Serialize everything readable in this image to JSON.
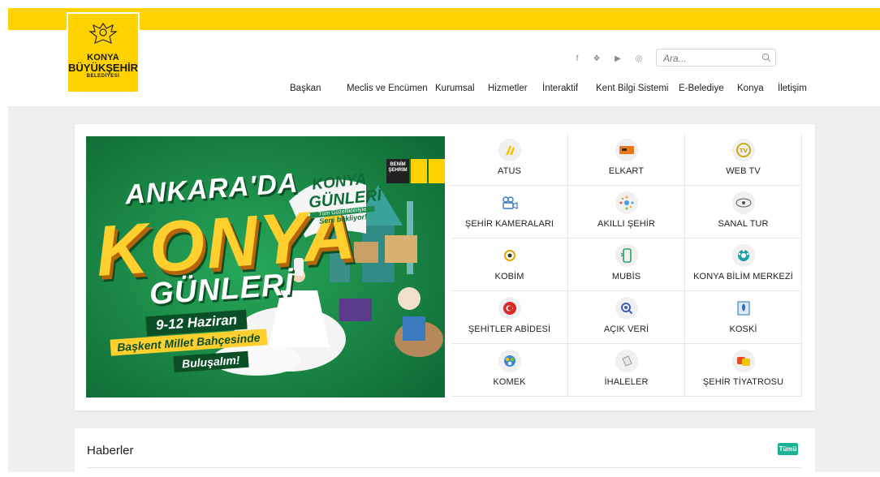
{
  "logo": {
    "line1": "KONYA",
    "line2": "BÜYÜKŞEHİR",
    "line3": "BELEDİYESİ"
  },
  "social": [
    {
      "name": "facebook-icon",
      "glyph": "f"
    },
    {
      "name": "twitter-icon",
      "glyph": "❖"
    },
    {
      "name": "youtube-icon",
      "glyph": "▶"
    },
    {
      "name": "instagram-icon",
      "glyph": "◎"
    }
  ],
  "search": {
    "placeholder": "Ara..."
  },
  "nav": [
    "Başkan",
    "Meclis ve Encümen",
    "Kurumsal",
    "Hizmetler",
    "İnteraktif",
    "Kent Bilgi Sistemi",
    "E-Belediye",
    "Konya",
    "İletişim"
  ],
  "banner": {
    "badge_line1": "BENİM",
    "badge_line2": "ŞEHRİM",
    "headline1": "ANKARA'DA",
    "headline2": "KONYA",
    "headline3": "GÜNLERİ",
    "right_title1": "KONYA",
    "right_title2": "GÜNLERİ",
    "right_sub": "Tüm Güzellikleriyle",
    "right_sub2": "Seni bekliyor!",
    "date": "9-12 Haziran",
    "place": "Başkent Millet Bahçesinde",
    "meet": "Buluşalım!"
  },
  "services": [
    {
      "label": "ATUS",
      "icon": "bus-icon",
      "color": "#f5c400"
    },
    {
      "label": "ELKART",
      "icon": "card-icon",
      "color": "#e8781b"
    },
    {
      "label": "WEB TV",
      "icon": "tv-icon",
      "color": "#c9a400"
    },
    {
      "label": "ŞEHİR KAMERALARI",
      "icon": "camera-icon",
      "color": "#3b7bbf"
    },
    {
      "label": "AKILLI ŞEHİR",
      "icon": "smart-city-icon",
      "color": "#4a9fd8"
    },
    {
      "label": "SANAL TUR",
      "icon": "virtual-tour-icon",
      "color": "#555555"
    },
    {
      "label": "KOBİM",
      "icon": "kobim-icon",
      "color": "#e8a000"
    },
    {
      "label": "MUBİS",
      "icon": "phone-icon",
      "color": "#2aa06a"
    },
    {
      "label": "KONYA BİLİM MERKEZİ",
      "icon": "science-center-icon",
      "color": "#1e9e9e"
    },
    {
      "label": "ŞEHİTLER ABİDESİ",
      "icon": "flag-icon",
      "color": "#d62b2b"
    },
    {
      "label": "AÇIK VERİ",
      "icon": "open-data-icon",
      "color": "#3d5fbf"
    },
    {
      "label": "KOSKİ",
      "icon": "koski-icon",
      "color": "#2a6fb5"
    },
    {
      "label": "KOMEK",
      "icon": "komek-icon",
      "color": "#3a8ad6"
    },
    {
      "label": "İHALELER",
      "icon": "tender-icon",
      "color": "#9a9a9a"
    },
    {
      "label": "ŞEHİR TİYATROSU",
      "icon": "theatre-icon",
      "color": "#e84b1f"
    }
  ],
  "news": {
    "title": "Haberler",
    "all_label": "Tümü"
  }
}
